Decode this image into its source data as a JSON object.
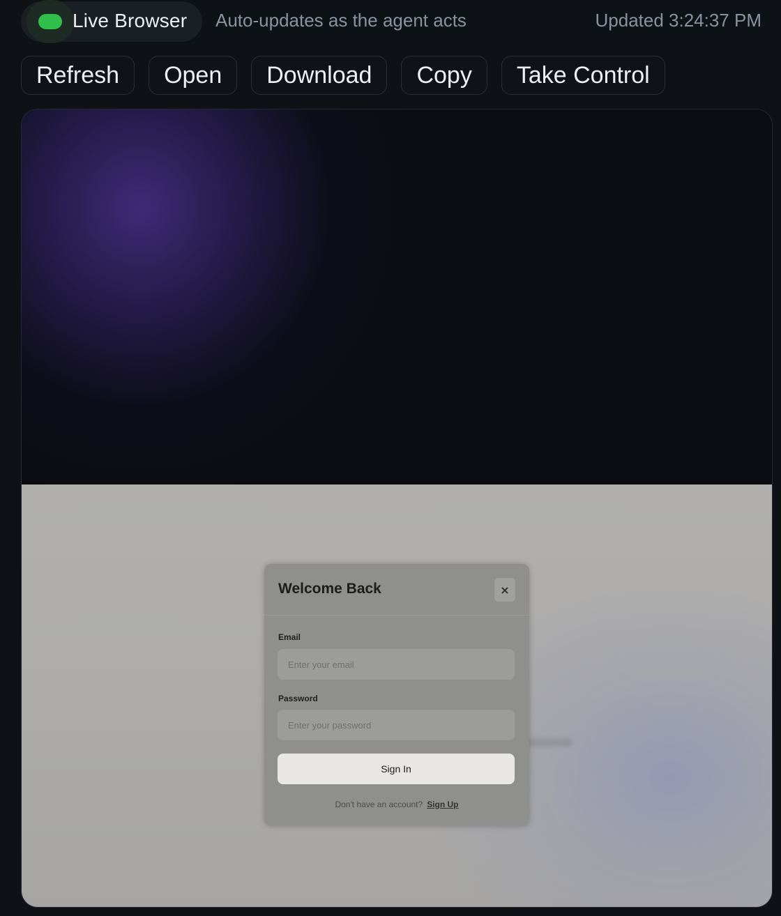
{
  "header": {
    "live_label": "Live Browser",
    "status_color": "#2fbf4a",
    "subtitle": "Auto-updates as the agent acts",
    "updated": "Updated 3:24:37 PM"
  },
  "toolbar": {
    "refresh": "Refresh",
    "open": "Open",
    "download": "Download",
    "copy": "Copy",
    "take_control": "Take Control"
  },
  "login_modal": {
    "title": "Welcome Back",
    "close_icon": "×",
    "email_label": "Email",
    "email_placeholder": "Enter your email",
    "password_label": "Password",
    "password_placeholder": "Enter your password",
    "signin_label": "Sign In",
    "footer_text": "Don't have an account?",
    "signup_label": "Sign Up"
  }
}
